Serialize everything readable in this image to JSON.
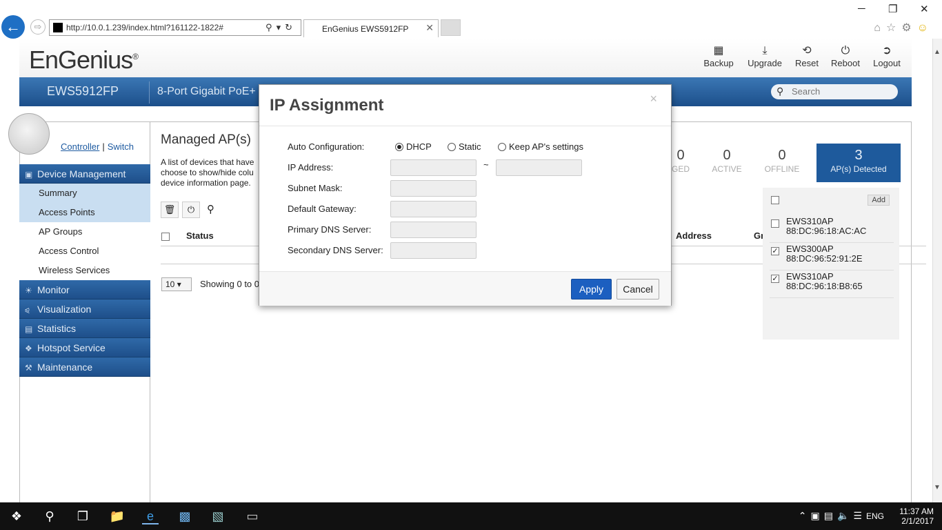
{
  "browser": {
    "url": "http://10.0.1.239/index.html?161122-1822#",
    "tab_title": "EnGenius EWS5912FP",
    "window_min": "─",
    "window_restore": "❐",
    "window_close": "✕"
  },
  "header": {
    "logo": "EnGenius",
    "logo_reg": "®",
    "buttons": [
      {
        "label": "Backup",
        "icon": "save-icon"
      },
      {
        "label": "Upgrade",
        "icon": "download-icon"
      },
      {
        "label": "Reset",
        "icon": "reset-icon"
      },
      {
        "label": "Reboot",
        "icon": "power-icon"
      },
      {
        "label": "Logout",
        "icon": "logout-icon"
      }
    ],
    "model": "EWS5912FP",
    "description": "8-Port Gigabit PoE+",
    "search_placeholder": "Search"
  },
  "mode": {
    "controller": "Controller",
    "separator": "|",
    "switch": "Switch"
  },
  "sidebar": {
    "sections": [
      {
        "label": "Device Management",
        "icon": "device-icon"
      },
      {
        "label": "Monitor",
        "icon": "monitor-icon"
      },
      {
        "label": "Visualization",
        "icon": "share-icon"
      },
      {
        "label": "Statistics",
        "icon": "chart-icon"
      },
      {
        "label": "Hotspot Service",
        "icon": "wifi-icon"
      },
      {
        "label": "Maintenance",
        "icon": "wrench-icon"
      }
    ],
    "subitems": [
      {
        "label": "Summary"
      },
      {
        "label": "Access Points"
      },
      {
        "label": "AP Groups"
      },
      {
        "label": "Access Control"
      },
      {
        "label": "Wireless Services"
      }
    ]
  },
  "content": {
    "title": "Managed AP(s)",
    "desc_lines": [
      "A list of devices that have",
      "choose to show/hide colu",
      "device information page."
    ],
    "col_status": "Status",
    "col_address": "Address",
    "col_gr": "Gr",
    "page_size": "10",
    "showing": "Showing 0 to 0"
  },
  "stats": [
    {
      "n": "0",
      "l": "GED"
    },
    {
      "n": "0",
      "l": "ACTIVE"
    },
    {
      "n": "0",
      "l": "OFFLINE"
    },
    {
      "n": "3",
      "l": "AP(s) Detected"
    }
  ],
  "ap_panel": {
    "add_label": "Add",
    "items": [
      {
        "name": "EWS310AP",
        "mac": "88:DC:96:18:AC:AC",
        "checked": false
      },
      {
        "name": "EWS300AP",
        "mac": "88:DC:96:52:91:2E",
        "checked": true
      },
      {
        "name": "EWS310AP",
        "mac": "88:DC:96:18:B8:65",
        "checked": true
      }
    ]
  },
  "modal": {
    "title": "IP Assignment",
    "close": "×",
    "auto_config_label": "Auto Configuration:",
    "options": [
      "DHCP",
      "Static",
      "Keep AP's settings"
    ],
    "selected_option": "DHCP",
    "fields": [
      {
        "label": "IP Address:",
        "value": ""
      },
      {
        "label": "Subnet Mask:",
        "value": ""
      },
      {
        "label": "Default Gateway:",
        "value": ""
      },
      {
        "label": "Primary DNS Server:",
        "value": ""
      },
      {
        "label": "Secondary DNS Server:",
        "value": ""
      }
    ],
    "ip_range_separator": "~",
    "apply": "Apply",
    "cancel": "Cancel"
  },
  "taskbar": {
    "lang": "ENG",
    "time": "11:37 AM",
    "date": "2/1/2017"
  },
  "colors": {
    "brand_blue": "#1e5a9c",
    "apply_blue": "#1c5fc0"
  }
}
